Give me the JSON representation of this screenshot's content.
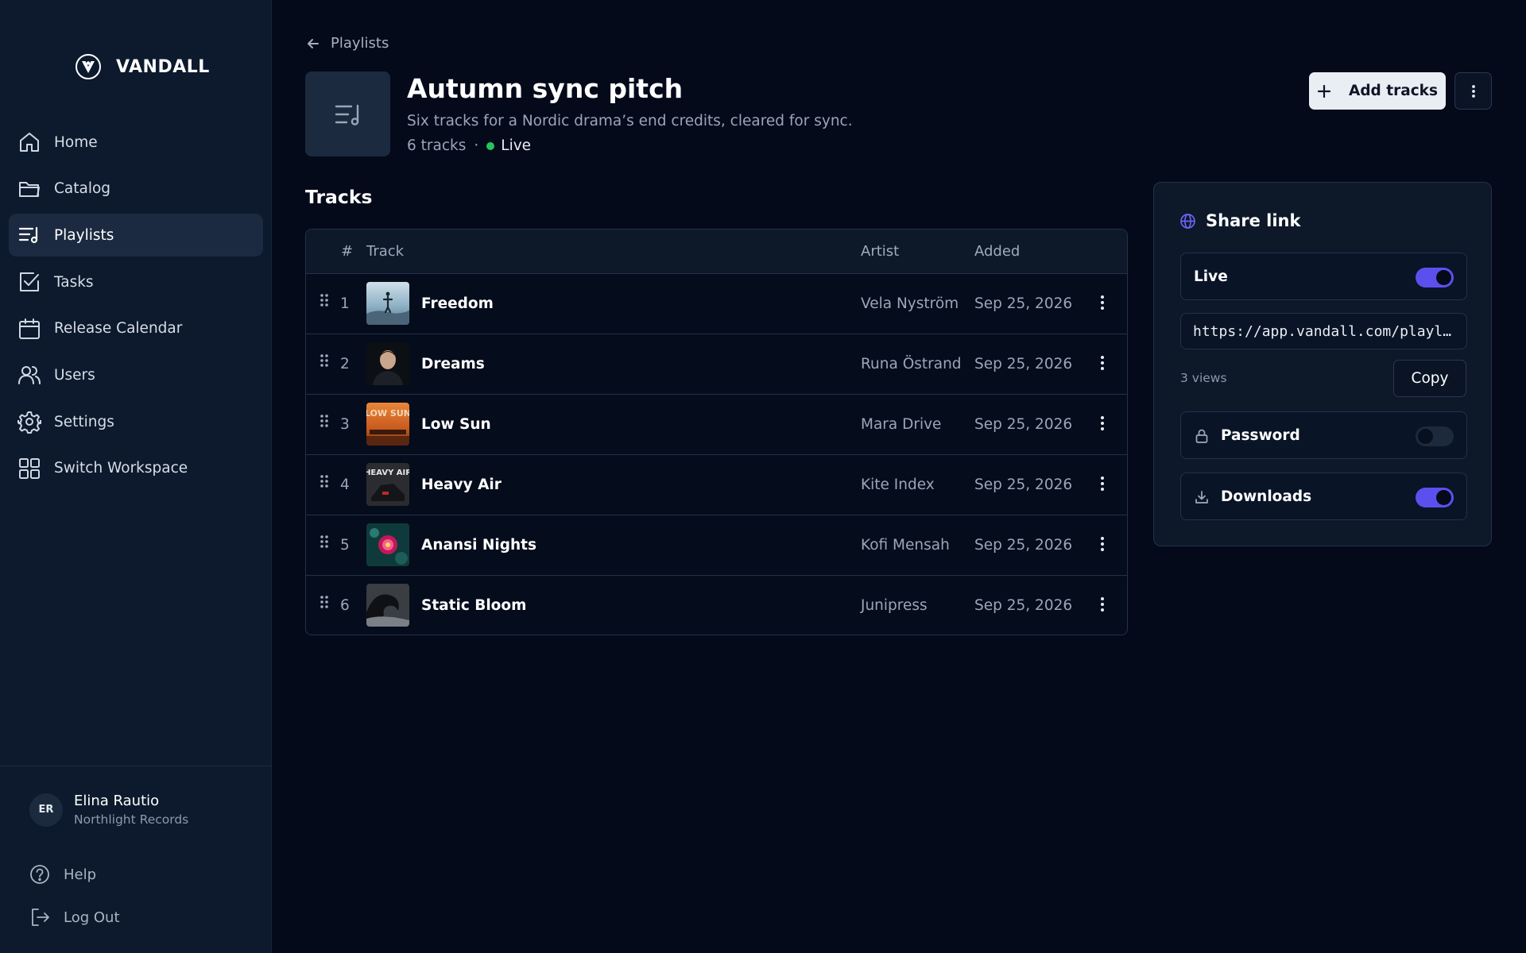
{
  "brand": {
    "name": "VANDALL"
  },
  "nav": {
    "items": [
      {
        "label": "Home",
        "icon": "home-icon"
      },
      {
        "label": "Catalog",
        "icon": "folder-icon"
      },
      {
        "label": "Playlists",
        "icon": "playlist-icon",
        "active": true
      },
      {
        "label": "Tasks",
        "icon": "checkbox-icon"
      },
      {
        "label": "Release Calendar",
        "icon": "calendar-icon"
      },
      {
        "label": "Users",
        "icon": "users-icon"
      },
      {
        "label": "Settings",
        "icon": "gear-icon"
      },
      {
        "label": "Switch Workspace",
        "icon": "grid-icon"
      }
    ]
  },
  "user": {
    "initials": "ER",
    "name": "Elina Rautio",
    "org": "Northlight Records"
  },
  "footer": {
    "help": "Help",
    "logout": "Log Out"
  },
  "header": {
    "back_label": "Playlists",
    "title": "Autumn sync pitch",
    "description": "Six tracks for a Nordic drama’s end credits, cleared for sync.",
    "track_count": "6 tracks",
    "separator": "·",
    "status": "Live",
    "add_tracks": "Add tracks"
  },
  "tracks": {
    "heading": "Tracks",
    "columns": {
      "num": "#",
      "track": "Track",
      "artist": "Artist",
      "added": "Added"
    },
    "rows": [
      {
        "num": "1",
        "name": "Freedom",
        "artist": "Vela Nyström",
        "added": "Sep 25, 2026"
      },
      {
        "num": "2",
        "name": "Dreams",
        "artist": "Runa Östrand",
        "added": "Sep 25, 2026"
      },
      {
        "num": "3",
        "name": "Low Sun",
        "artist": "Mara Drive",
        "added": "Sep 25, 2026",
        "art_text": "LOW SUN"
      },
      {
        "num": "4",
        "name": "Heavy Air",
        "artist": "Kite Index",
        "added": "Sep 25, 2026",
        "art_text": "HEAVY AIR"
      },
      {
        "num": "5",
        "name": "Anansi Nights",
        "artist": "Kofi Mensah",
        "added": "Sep 25, 2026"
      },
      {
        "num": "6",
        "name": "Static Bloom",
        "artist": "Junipress",
        "added": "Sep 25, 2026"
      }
    ]
  },
  "share": {
    "title": "Share link",
    "live_label": "Live",
    "live_on": true,
    "url": "https://app.vandall.com/playlists/autumn-sync-pitch",
    "views": "3 views",
    "copy_label": "Copy",
    "password_label": "Password",
    "password_on": false,
    "downloads_label": "Downloads",
    "downloads_on": true
  },
  "colors": {
    "accent": "#5b50ee",
    "live": "#22c55e",
    "background": "#040a1a",
    "sidebar": "#0d1a2d"
  }
}
